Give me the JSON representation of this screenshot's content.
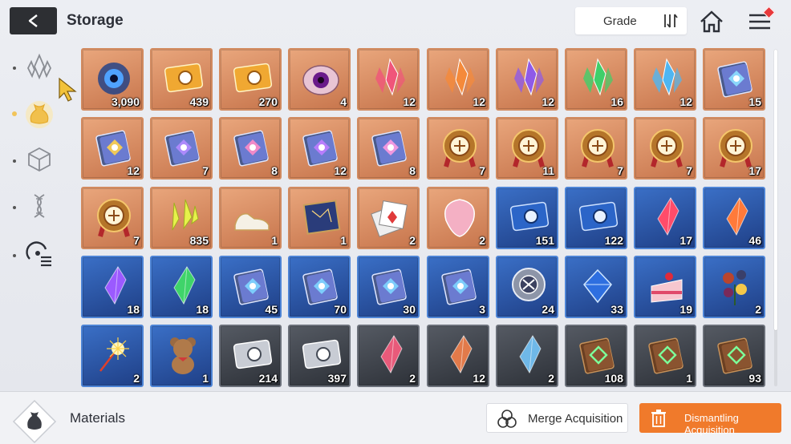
{
  "header": {
    "title": "Storage",
    "grade_label": "Grade"
  },
  "sidebar": {
    "tabs": [
      "crystals-icon",
      "materials-bag-icon",
      "cube-icon",
      "dna-icon",
      "gauge-list-icon"
    ],
    "selected": 1
  },
  "items": [
    {
      "name": "cosmic-eye-item",
      "grade": "orange",
      "icon": "cosmic",
      "qty": "3,090"
    },
    {
      "name": "gold-ticket-item",
      "grade": "orange",
      "icon": "ticket-gold",
      "qty": "439"
    },
    {
      "name": "compass-ticket-item",
      "grade": "orange",
      "icon": "ticket-compass",
      "qty": "270"
    },
    {
      "name": "purple-eye-orb-item",
      "grade": "orange",
      "icon": "eye-orb",
      "qty": "4"
    },
    {
      "name": "red-crystal-item",
      "grade": "orange",
      "icon": "crystal",
      "color": "#f0557a",
      "qty": "12"
    },
    {
      "name": "orange-crystal-item",
      "grade": "orange",
      "icon": "crystal",
      "color": "#f58a3a",
      "qty": "12"
    },
    {
      "name": "purple-crystal-item",
      "grade": "orange",
      "icon": "crystal",
      "color": "#8f5ae8",
      "qty": "12"
    },
    {
      "name": "green-crystal-item",
      "grade": "orange",
      "icon": "crystal",
      "color": "#3fcf6a",
      "qty": "16"
    },
    {
      "name": "blue-crystal-item",
      "grade": "orange",
      "icon": "crystal",
      "color": "#4fb6f2",
      "qty": "12"
    },
    {
      "name": "sword-book-item",
      "grade": "orange",
      "icon": "book",
      "color": "#8ee0ff",
      "qty": "15"
    },
    {
      "name": "shield-book-item",
      "grade": "orange",
      "icon": "book",
      "color": "#ffd24a",
      "qty": "12"
    },
    {
      "name": "target-book-item",
      "grade": "orange",
      "icon": "book",
      "color": "#b48cff",
      "qty": "7"
    },
    {
      "name": "wings-book-item",
      "grade": "orange",
      "icon": "book",
      "color": "#ff8cc6",
      "qty": "8"
    },
    {
      "name": "slash-book-item",
      "grade": "orange",
      "icon": "book",
      "color": "#c07dff",
      "qty": "12"
    },
    {
      "name": "globe-book-item",
      "grade": "orange",
      "icon": "book",
      "color": "#ff9be0",
      "qty": "8"
    },
    {
      "name": "sword-medal-item",
      "grade": "orange",
      "icon": "medal",
      "qty": "7"
    },
    {
      "name": "shield-medal-item",
      "grade": "orange",
      "icon": "medal",
      "qty": "11"
    },
    {
      "name": "target-medal-item",
      "grade": "orange",
      "icon": "medal",
      "qty": "7"
    },
    {
      "name": "wings-medal-item",
      "grade": "orange",
      "icon": "medal",
      "qty": "7"
    },
    {
      "name": "slash-medal-item",
      "grade": "orange",
      "icon": "medal",
      "qty": "17"
    },
    {
      "name": "globe-medal-item",
      "grade": "orange",
      "icon": "medal",
      "qty": "7"
    },
    {
      "name": "yellow-shards-item",
      "grade": "orange",
      "icon": "shards",
      "qty": "835"
    },
    {
      "name": "sneakers-item",
      "grade": "orange",
      "icon": "sneakers",
      "qty": "1"
    },
    {
      "name": "star-map-item",
      "grade": "orange",
      "icon": "map",
      "qty": "1"
    },
    {
      "name": "playing-cards-item",
      "grade": "orange",
      "icon": "cards",
      "qty": "2"
    },
    {
      "name": "pink-pick-item",
      "grade": "orange",
      "icon": "pick",
      "qty": "2"
    },
    {
      "name": "blue-ticket-portrait-item",
      "grade": "blue",
      "icon": "ticket-blue",
      "qty": "151"
    },
    {
      "name": "blue-ticket-compass-item",
      "grade": "blue",
      "icon": "ticket-blue",
      "qty": "122"
    },
    {
      "name": "red-shard-blue-item",
      "grade": "blue",
      "icon": "shard",
      "color": "#ff4c6a",
      "qty": "17"
    },
    {
      "name": "orange-shard-blue-item",
      "grade": "blue",
      "icon": "shard",
      "color": "#ff7a3a",
      "qty": "46"
    },
    {
      "name": "purple-shard-blue-item",
      "grade": "blue",
      "icon": "shard",
      "color": "#9b5aff",
      "qty": "18"
    },
    {
      "name": "green-shard-blue-item",
      "grade": "blue",
      "icon": "shard",
      "color": "#3fd46a",
      "qty": "18"
    },
    {
      "name": "sword-book-blue-item",
      "grade": "blue",
      "icon": "book",
      "color": "#7fd6ff",
      "qty": "45"
    },
    {
      "name": "target-book-blue-item",
      "grade": "blue",
      "icon": "book",
      "color": "#7fd6ff",
      "qty": "70"
    },
    {
      "name": "wings-book-blue-item",
      "grade": "blue",
      "icon": "book",
      "color": "#7fd6ff",
      "qty": "30"
    },
    {
      "name": "slash-book-blue-item",
      "grade": "blue",
      "icon": "book",
      "color": "#7fd6ff",
      "qty": "3"
    },
    {
      "name": "silver-medal-item",
      "grade": "blue",
      "icon": "medal-silver",
      "qty": "24"
    },
    {
      "name": "blue-gem-item",
      "grade": "blue",
      "icon": "gem",
      "qty": "33"
    },
    {
      "name": "strawberry-cake-item",
      "grade": "blue",
      "icon": "cake",
      "qty": "19"
    },
    {
      "name": "flower-bouquet-item",
      "grade": "blue",
      "icon": "flowers",
      "qty": "2"
    },
    {
      "name": "sparkler-item",
      "grade": "blue",
      "icon": "sparkler",
      "qty": "2"
    },
    {
      "name": "teddy-bear-item",
      "grade": "blue",
      "icon": "bear",
      "qty": "1"
    },
    {
      "name": "silver-ticket-portrait-item",
      "grade": "gray",
      "icon": "ticket-silver",
      "qty": "214"
    },
    {
      "name": "silver-ticket-compass-item",
      "grade": "gray",
      "icon": "ticket-silver",
      "qty": "397"
    },
    {
      "name": "red-shard-gray-item",
      "grade": "gray",
      "icon": "shard",
      "color": "#e85a7a",
      "qty": "2"
    },
    {
      "name": "orange-shard-gray-item",
      "grade": "gray",
      "icon": "shard",
      "color": "#e27a4a",
      "qty": "12"
    },
    {
      "name": "blue-shard-gray-item",
      "grade": "gray",
      "icon": "shard",
      "color": "#6fb8e8",
      "qty": "2"
    },
    {
      "name": "sword-book-gray-item",
      "grade": "gray",
      "icon": "book-brown",
      "color": "#7cff9a",
      "qty": "108"
    },
    {
      "name": "shield-book-gray-item",
      "grade": "gray",
      "icon": "book-brown",
      "color": "#7cff9a",
      "qty": "1"
    },
    {
      "name": "target-book-gray-item",
      "grade": "gray",
      "icon": "book-brown",
      "color": "#7cff9a",
      "qty": "93"
    }
  ],
  "footer": {
    "category_label": "Materials",
    "merge_label": "Merge Acquisition",
    "dismantle_label": "Dismantling Acquisition"
  },
  "colors": {
    "accent": "#f07a2b",
    "orange_grade": "#d28a5f",
    "blue_grade": "#4d84d6",
    "gray_grade": "#6b707a"
  }
}
